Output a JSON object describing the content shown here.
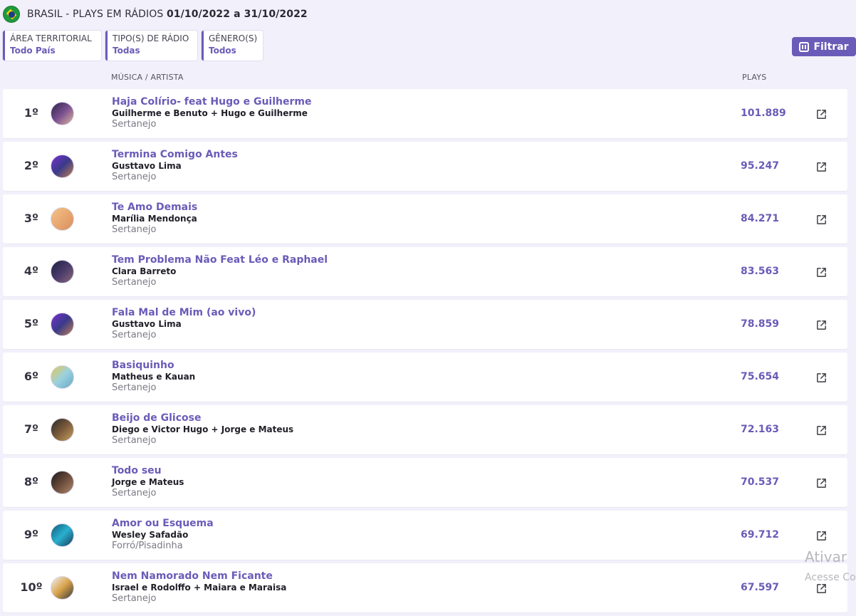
{
  "header": {
    "title_prefix": "BRASIL - PLAYS EM RÁDIOS",
    "date_range": "01/10/2022 a 31/10/2022",
    "flag_icon": "brazil-flag-icon"
  },
  "filters": [
    {
      "label": "ÁREA TERRITORIAL",
      "value": "Todo País"
    },
    {
      "label": "TIPO(S) DE RÁDIO",
      "value": "Todas"
    },
    {
      "label": "GÊNERO(S)",
      "value": "Todos"
    }
  ],
  "filter_button": {
    "label": "Filtrar",
    "icon": "sliders-icon"
  },
  "columns": {
    "music": "MÚSICA / ARTISTA",
    "plays": "PLAYS"
  },
  "accent_color": "#6b5bb8",
  "rows": [
    {
      "rank": "1º",
      "song": "Haja Colírio- feat Hugo e Guilherme",
      "artist": "Guilherme e Benuto + Hugo e Guilherme",
      "genre": "Sertanejo",
      "plays": "101.889"
    },
    {
      "rank": "2º",
      "song": "Termina Comigo Antes",
      "artist": "Gusttavo Lima",
      "genre": "Sertanejo",
      "plays": "95.247"
    },
    {
      "rank": "3º",
      "song": "Te Amo Demais",
      "artist": "Marília Mendonça",
      "genre": "Sertanejo",
      "plays": "84.271"
    },
    {
      "rank": "4º",
      "song": "Tem Problema Não Feat Léo e Raphael",
      "artist": "Clara Barreto",
      "genre": "Sertanejo",
      "plays": "83.563"
    },
    {
      "rank": "5º",
      "song": "Fala Mal de Mim (ao vivo)",
      "artist": "Gusttavo Lima",
      "genre": "Sertanejo",
      "plays": "78.859"
    },
    {
      "rank": "6º",
      "song": "Basiquinho",
      "artist": "Matheus e Kauan",
      "genre": "Sertanejo",
      "plays": "75.654"
    },
    {
      "rank": "7º",
      "song": "Beijo de Glicose",
      "artist": "Diego e Victor Hugo + Jorge e Mateus",
      "genre": "Sertanejo",
      "plays": "72.163"
    },
    {
      "rank": "8º",
      "song": "Todo seu",
      "artist": "Jorge e Mateus",
      "genre": "Sertanejo",
      "plays": "70.537"
    },
    {
      "rank": "9º",
      "song": "Amor ou Esquema",
      "artist": "Wesley Safadão",
      "genre": "Forró/Pisadinha",
      "plays": "69.712"
    },
    {
      "rank": "10º",
      "song": "Nem Namorado Nem Ficante",
      "artist": "Israel e Rodolffo + Maiara e Maraisa",
      "genre": "Sertanejo",
      "plays": "67.597"
    }
  ],
  "watermark": {
    "title": "Ativar",
    "subtitle": "Acesse Co"
  }
}
